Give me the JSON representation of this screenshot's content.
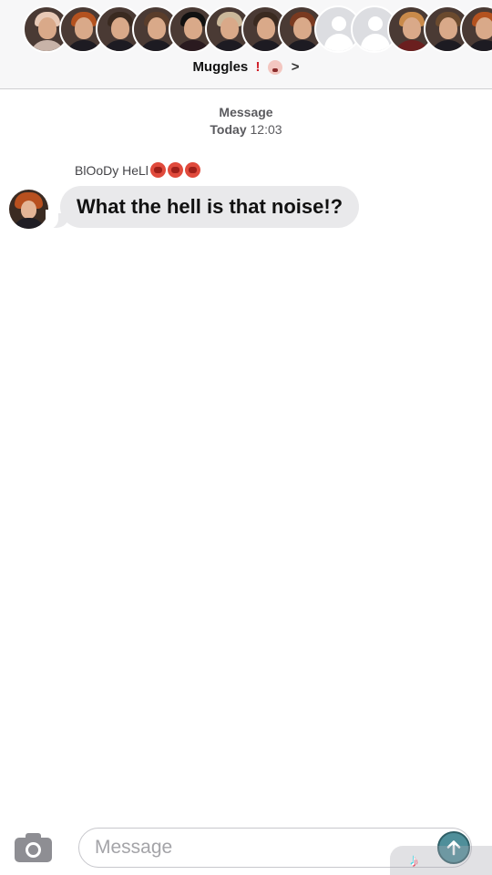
{
  "header": {
    "group_name": "Muggles",
    "group_suffix_glyph": "!",
    "chevron_glyph": ">",
    "participants": [
      {
        "icon": "avatar-photo",
        "hair": "#e8c9b6",
        "robe": "#c8b3a8"
      },
      {
        "icon": "avatar-photo",
        "hair": "#b4521f",
        "robe": "#1d1b22"
      },
      {
        "icon": "avatar-photo",
        "hair": "#3a2a20",
        "robe": "#1d1b22"
      },
      {
        "icon": "avatar-photo",
        "hair": "#5a3d2b",
        "robe": "#1d1b22"
      },
      {
        "icon": "avatar-photo",
        "hair": "#111111",
        "robe": "#2a1a1f"
      },
      {
        "icon": "avatar-photo",
        "hair": "#cbb89a",
        "robe": "#1d1b22"
      },
      {
        "icon": "avatar-photo",
        "hair": "#3a2a20",
        "robe": "#1d1b22"
      },
      {
        "icon": "avatar-photo",
        "hair": "#7a3a20",
        "robe": "#1d1b22"
      },
      {
        "icon": "avatar-placeholder"
      },
      {
        "icon": "avatar-placeholder"
      },
      {
        "icon": "avatar-photo",
        "hair": "#c98a4a",
        "robe": "#6b1f1f"
      },
      {
        "icon": "avatar-photo",
        "hair": "#6b4a2e",
        "robe": "#1d1b22"
      },
      {
        "icon": "avatar-photo",
        "hair": "#b4521f",
        "robe": "#1d1b22"
      }
    ]
  },
  "thread": {
    "service_label": "Message",
    "day_label": "Today",
    "time_label": "12:03"
  },
  "messages": [
    {
      "sender": "BlOoDy HeLl",
      "sender_emoji": [
        "angry-face-icon",
        "angry-face-icon",
        "angry-face-icon"
      ],
      "text": "What the hell is that noise!?"
    }
  ],
  "composer": {
    "placeholder": "Message",
    "value": ""
  },
  "colors": {
    "bubble_incoming": "#e9e9eb",
    "send_button": "#4f8f9a",
    "header_bg": "#f7f7f8"
  }
}
